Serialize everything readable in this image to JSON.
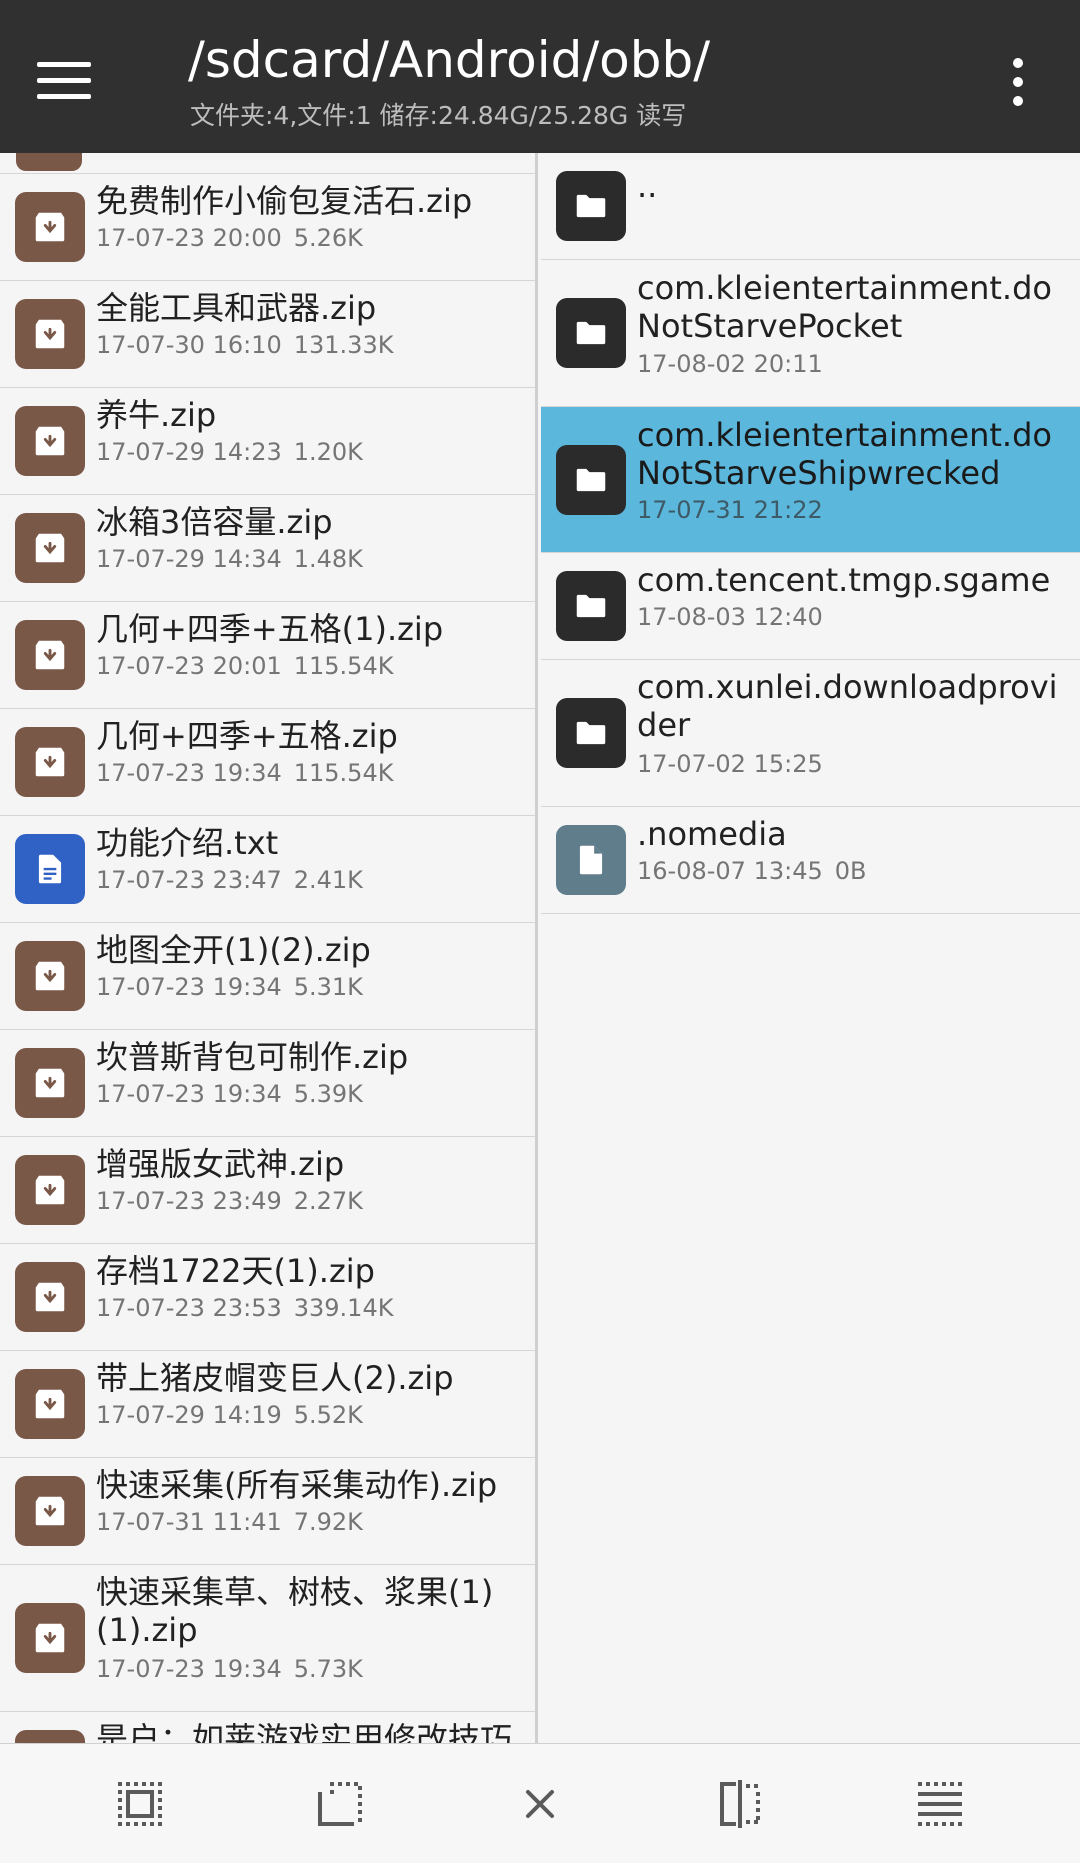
{
  "header": {
    "path": "/sdcard/Android/obb/",
    "subtitle": "文件夹:4,文件:1  储存:24.84G/25.28G  读写",
    "menu_icon": "hamburger-menu-icon",
    "more_icon": "more-vert-icon",
    "bg_color": "#303030"
  },
  "left_pane": {
    "items": [
      {
        "name": "免费制作小偷包复活石.zip",
        "date": "17-07-23 20:00",
        "size": "5.26K",
        "type": "zip"
      },
      {
        "name": "全能工具和武器.zip",
        "date": "17-07-30 16:10",
        "size": "131.33K",
        "type": "zip"
      },
      {
        "name": "养牛.zip",
        "date": "17-07-29 14:23",
        "size": "1.20K",
        "type": "zip"
      },
      {
        "name": "冰箱3倍容量.zip",
        "date": "17-07-29 14:34",
        "size": "1.48K",
        "type": "zip"
      },
      {
        "name": "几何+四季+五格(1).zip",
        "date": "17-07-23 20:01",
        "size": "115.54K",
        "type": "zip"
      },
      {
        "name": "几何+四季+五格.zip",
        "date": "17-07-23 19:34",
        "size": "115.54K",
        "type": "zip"
      },
      {
        "name": "功能介绍.txt",
        "date": "17-07-23 23:47",
        "size": "2.41K",
        "type": "txt"
      },
      {
        "name": "地图全开(1)(2).zip",
        "date": "17-07-23 19:34",
        "size": "5.31K",
        "type": "zip"
      },
      {
        "name": "坎普斯背包可制作.zip",
        "date": "17-07-23 19:34",
        "size": "5.39K",
        "type": "zip"
      },
      {
        "name": "增强版女武神.zip",
        "date": "17-07-23 23:49",
        "size": "2.27K",
        "type": "zip"
      },
      {
        "name": "存档1722天(1).zip",
        "date": "17-07-23 23:53",
        "size": "339.14K",
        "type": "zip"
      },
      {
        "name": "带上猪皮帽变巨人(2).zip",
        "date": "17-07-29 14:19",
        "size": "5.52K",
        "type": "zip"
      },
      {
        "name": "快速采集(所有采集动作).zip",
        "date": "17-07-31 11:41",
        "size": "7.92K",
        "type": "zip"
      },
      {
        "name": "快速采集草、树枝、浆果(1)(1).zip",
        "date": "17-07-23 19:34",
        "size": "5.73K",
        "type": "zip"
      },
      {
        "name": "是户：如莱游戏实用修改技巧",
        "date": "",
        "size": "",
        "type": "zip"
      }
    ]
  },
  "right_pane": {
    "items": [
      {
        "name": "..",
        "date": "",
        "size": "",
        "type": "folder",
        "selected": false
      },
      {
        "name": "com.kleientertainment.doNotStarvePocket",
        "date": "17-08-02 20:11",
        "size": "",
        "type": "folder",
        "selected": false
      },
      {
        "name": "com.kleientertainment.doNotStarveShipwrecked",
        "date": "17-07-31 21:22",
        "size": "",
        "type": "folder",
        "selected": true
      },
      {
        "name": "com.tencent.tmgp.sgame",
        "date": "17-08-03 12:40",
        "size": "",
        "type": "folder",
        "selected": false
      },
      {
        "name": "com.xunlei.downloadprovider",
        "date": "17-07-02 15:25",
        "size": "",
        "type": "folder",
        "selected": false
      },
      {
        "name": ".nomedia",
        "date": "16-08-07 13:45",
        "size": "0B",
        "type": "nomedia",
        "selected": false
      }
    ],
    "selected_color": "#5bb7dc"
  },
  "toolbar": {
    "buttons": [
      {
        "icon": "select-all-icon"
      },
      {
        "icon": "select-range-icon"
      },
      {
        "icon": "close-icon"
      },
      {
        "icon": "split-pane-icon"
      },
      {
        "icon": "list-select-icon"
      }
    ]
  }
}
